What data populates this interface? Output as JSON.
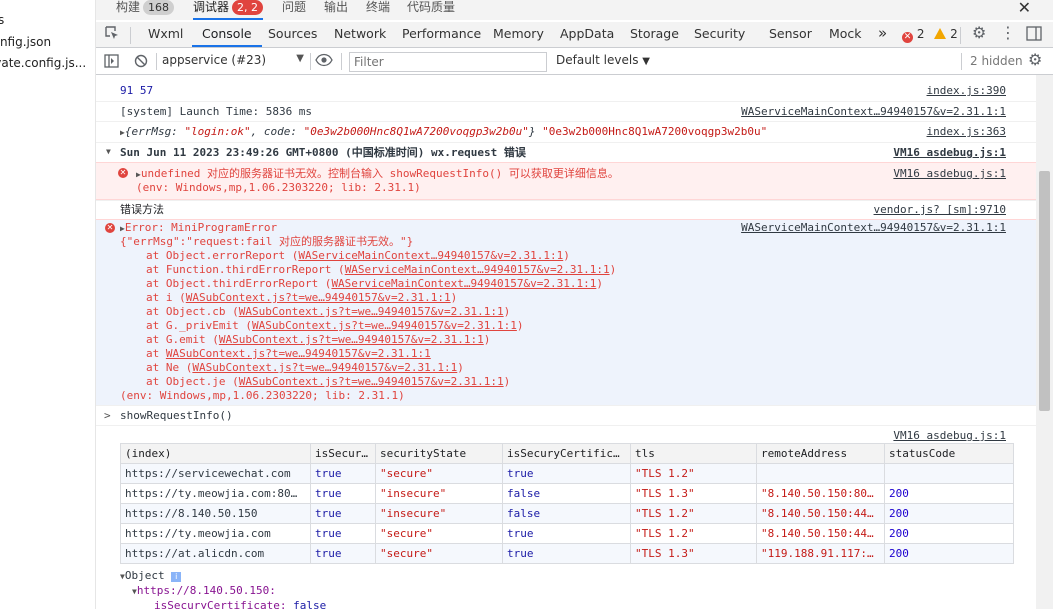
{
  "left_panel": {
    "files": [
      "s",
      "config.json",
      "rivate.config.js..."
    ]
  },
  "top_tabs": [
    {
      "label": "构建",
      "count": "168",
      "count_style": "grey"
    },
    {
      "label": "调试器",
      "count": "2, 2",
      "count_style": "red",
      "active": true
    },
    {
      "label": "问题"
    },
    {
      "label": "输出"
    },
    {
      "label": "终端"
    },
    {
      "label": "代码质量"
    }
  ],
  "panel_tabs": [
    "Wxml",
    "Console",
    "Sources",
    "Network",
    "Performance",
    "Memory",
    "AppData",
    "Storage",
    "Security",
    "Sensor",
    "Mock"
  ],
  "active_panel_tab": "Console",
  "error_badge": {
    "errors": "2",
    "warnings": "2"
  },
  "console_toolbar": {
    "context": "appservice (#23)",
    "filter_placeholder": "Filter",
    "levels": "Default levels",
    "hidden": "2 hidden"
  },
  "console": {
    "log1": {
      "text": "91 57",
      "source": "index.js:390"
    },
    "log2": {
      "text": "[system] Launch Time: 5836 ms",
      "source": "WAServiceMainContext…94940157&v=2.31.1:1"
    },
    "log3": {
      "prefix": "{errMsg: ",
      "errmsg_val": "\"login:ok\"",
      "code_key": ", code: ",
      "code_val": "\"0e3w2b000Hnc8Q1wA7200voqgp3w2b0u\"",
      "suffix": "}",
      "tail": "\"0e3w2b000Hnc8Q1wA7200voqgp3w2b0u\"",
      "source": "index.js:363"
    },
    "group": {
      "text": "Sun Jun 11 2023 23:49:26 GMT+0800 (中国标准时间) wx.request 错误",
      "source": "VM16 asdebug.js:1"
    },
    "warn1": {
      "line1": "undefined 对应的服务器证书无效。控制台输入 showRequestInfo() 可以获取更详细信息。",
      "line2": "(env: Windows,mp,1.06.2303220; lib: 2.31.1)",
      "source": "VM16 asdebug.js:1"
    },
    "log4": {
      "text": "错误方法",
      "source": "vendor.js? [sm]:9710"
    },
    "error2": {
      "title": "Error: MiniProgramError",
      "errmsg": "{\"errMsg\":\"request:fail 对应的服务器证书无效。\"}",
      "source": "WAServiceMainContext…94940157&v=2.31.1:1",
      "stack": [
        {
          "fn": "at Object.errorReport (",
          "link": "WAServiceMainContext…94940157&v=2.31.1:1",
          "end": ")"
        },
        {
          "fn": "at Function.thirdErrorReport (",
          "link": "WAServiceMainContext…94940157&v=2.31.1:1",
          "end": ")"
        },
        {
          "fn": "at Object.thirdErrorReport (",
          "link": "WAServiceMainContext…94940157&v=2.31.1:1",
          "end": ")"
        },
        {
          "fn": "at i (",
          "link": "WASubContext.js?t=we…94940157&v=2.31.1:1",
          "end": ")"
        },
        {
          "fn": "at Object.cb (",
          "link": "WASubContext.js?t=we…94940157&v=2.31.1:1",
          "end": ")"
        },
        {
          "fn": "at G._privEmit (",
          "link": "WASubContext.js?t=we…94940157&v=2.31.1:1",
          "end": ")"
        },
        {
          "fn": "at G.emit (",
          "link": "WASubContext.js?t=we…94940157&v=2.31.1:1",
          "end": ")"
        },
        {
          "fn": "at ",
          "link": "WASubContext.js?t=we…94940157&v=2.31.1:1",
          "end": ""
        },
        {
          "fn": "at Ne (",
          "link": "WASubContext.js?t=we…94940157&v=2.31.1:1",
          "end": ")"
        },
        {
          "fn": "at Object.je (",
          "link": "WASubContext.js?t=we…94940157&v=2.31.1:1",
          "end": ")"
        }
      ],
      "env": "(env: Windows,mp,1.06.2303220; lib: 2.31.1)"
    },
    "input": {
      "prompt": ">",
      "text": "showRequestInfo()"
    },
    "table_source": "VM16 asdebug.js:1",
    "table": {
      "headers": [
        "(index)",
        "isSecur…",
        "securityState",
        "isSecuryCertifica…",
        "tls",
        "remoteAddress",
        "statusCode"
      ],
      "rows": [
        [
          "https://servicewechat.com",
          "true",
          "\"secure\"",
          "true",
          "\"TLS 1.2\"",
          "",
          ""
        ],
        [
          "https://ty.meowjia.com:80…",
          "true",
          "\"insecure\"",
          "false",
          "\"TLS 1.3\"",
          "\"8.140.50.150:800…",
          "200"
        ],
        [
          "https://8.140.50.150",
          "true",
          "\"insecure\"",
          "false",
          "\"TLS 1.2\"",
          "\"8.140.50.150:443\"",
          "200"
        ],
        [
          "https://ty.meowjia.com",
          "true",
          "\"secure\"",
          "true",
          "\"TLS 1.2\"",
          "\"8.140.50.150:443\"",
          "200"
        ],
        [
          "https://at.alicdn.com",
          "true",
          "\"secure\"",
          "true",
          "\"TLS 1.3\"",
          "\"119.188.91.117:4…",
          "200"
        ]
      ]
    },
    "object": {
      "label": "Object",
      "child": "https://8.140.50.150:",
      "prop_key": "isSecuryCertificate:",
      "prop_val": "false"
    }
  }
}
